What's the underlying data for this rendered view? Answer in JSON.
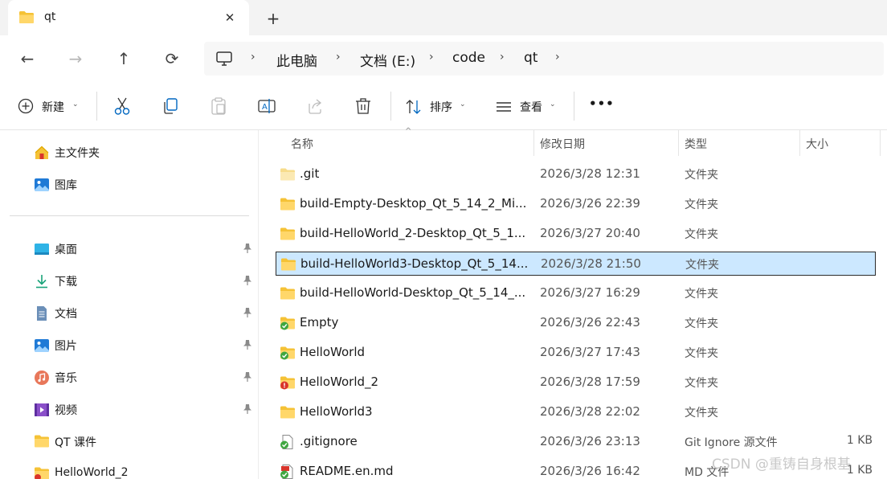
{
  "tab": {
    "title": "qt",
    "close": "✕",
    "new_tab": "+"
  },
  "nav": {
    "back": "←",
    "forward": "→",
    "up": "↑",
    "refresh": "⟳"
  },
  "breadcrumb": {
    "items": [
      "此电脑",
      "文档 (E:)",
      "code",
      "qt"
    ],
    "separator": "›"
  },
  "toolbar": {
    "new_label": "新建",
    "sort_label": "排序",
    "view_label": "查看",
    "more_label": "•••",
    "chevron": "⌄",
    "icons": [
      "add-circle-icon",
      "cut-icon",
      "copy-icon",
      "paste-icon",
      "rename-icon",
      "share-icon",
      "delete-icon",
      "sort-icon",
      "view-icon",
      "more-icon"
    ]
  },
  "sidebar": {
    "quick": [
      {
        "label": "主文件夹",
        "icon": "home-icon"
      },
      {
        "label": "图库",
        "icon": "gallery-icon"
      }
    ],
    "pinned": [
      {
        "label": "桌面",
        "icon": "desktop-icon",
        "pinned": true
      },
      {
        "label": "下载",
        "icon": "download-icon",
        "pinned": true
      },
      {
        "label": "文档",
        "icon": "document-icon",
        "pinned": true
      },
      {
        "label": "图片",
        "icon": "pictures-icon",
        "pinned": true
      },
      {
        "label": "音乐",
        "icon": "music-icon",
        "pinned": true
      },
      {
        "label": "视频",
        "icon": "video-icon",
        "pinned": true
      },
      {
        "label": "QT 课件",
        "icon": "folder-icon",
        "pinned": false
      },
      {
        "label": "HelloWorld_2",
        "icon": "folder-icon",
        "pinned": false
      }
    ]
  },
  "columns": {
    "name": "名称",
    "modified": "修改日期",
    "type": "类型",
    "size": "大小"
  },
  "files": [
    {
      "name": ".git",
      "date": "2026/3/28 12:31",
      "type": "文件夹",
      "size": "",
      "icon": "folder-light-icon",
      "selected": false
    },
    {
      "name": "build-Empty-Desktop_Qt_5_14_2_Mi...",
      "date": "2026/3/26 22:39",
      "type": "文件夹",
      "size": "",
      "icon": "folder-icon",
      "selected": false
    },
    {
      "name": "build-HelloWorld_2-Desktop_Qt_5_1...",
      "date": "2026/3/27 20:40",
      "type": "文件夹",
      "size": "",
      "icon": "folder-icon",
      "selected": false
    },
    {
      "name": "build-HelloWorld3-Desktop_Qt_5_14...",
      "date": "2026/3/28 21:50",
      "type": "文件夹",
      "size": "",
      "icon": "folder-icon",
      "selected": true
    },
    {
      "name": "build-HelloWorld-Desktop_Qt_5_14_...",
      "date": "2026/3/27 16:29",
      "type": "文件夹",
      "size": "",
      "icon": "folder-icon",
      "selected": false
    },
    {
      "name": "Empty",
      "date": "2026/3/26 22:43",
      "type": "文件夹",
      "size": "",
      "icon": "folder-git-ok-icon",
      "selected": false
    },
    {
      "name": "HelloWorld",
      "date": "2026/3/27 17:43",
      "type": "文件夹",
      "size": "",
      "icon": "folder-git-ok-icon",
      "selected": false
    },
    {
      "name": "HelloWorld_2",
      "date": "2026/3/28 17:59",
      "type": "文件夹",
      "size": "",
      "icon": "folder-git-modified-icon",
      "selected": false
    },
    {
      "name": "HelloWorld3",
      "date": "2026/3/28 22:02",
      "type": "文件夹",
      "size": "",
      "icon": "folder-icon",
      "selected": false
    },
    {
      "name": ".gitignore",
      "date": "2026/3/26 23:13",
      "type": "Git Ignore 源文件",
      "size": "1 KB",
      "icon": "file-git-ok-icon",
      "selected": false
    },
    {
      "name": "README.en.md",
      "date": "2026/3/26 16:42",
      "type": "MD 文件",
      "size": "1 KB",
      "icon": "file-md-git-icon",
      "selected": false
    }
  ],
  "watermark": "CSDN @重铸自身根基",
  "colors": {
    "selection": "#cce8ff",
    "folder": "#f5c236",
    "accent": "#0067c0",
    "git_ok": "#3fa640",
    "git_modified": "#d9352b"
  }
}
